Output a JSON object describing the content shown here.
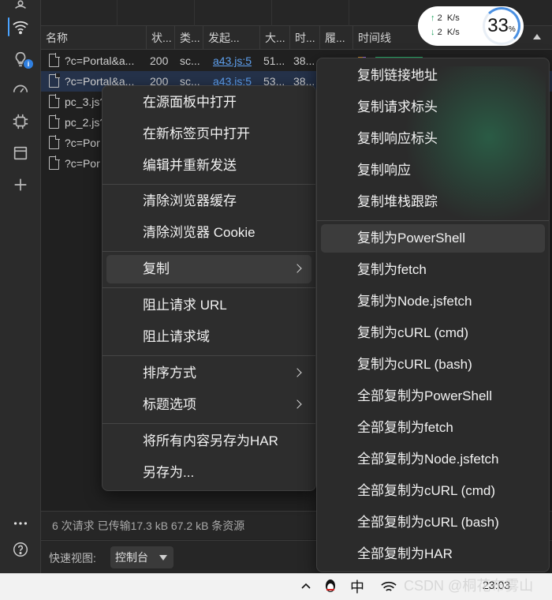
{
  "columns": [
    "名称",
    "状...",
    "类...",
    "发起...",
    "大...",
    "时...",
    "履...",
    "时间线"
  ],
  "rows": [
    {
      "name": "?c=Portal&a...",
      "status": "200",
      "type": "sc...",
      "initiator": "a43.js:5",
      "size": "51...",
      "time": "38..."
    },
    {
      "name": "?c=Portal&a...",
      "status": "200",
      "type": "sc...",
      "initiator": "a43.js:5",
      "size": "53...",
      "time": "38..."
    },
    {
      "name": "pc_3.js?",
      "status": "",
      "type": "",
      "initiator": "",
      "size": "",
      "time": ""
    },
    {
      "name": "pc_2.js?",
      "status": "",
      "type": "",
      "initiator": "",
      "size": "",
      "time": ""
    },
    {
      "name": "?c=Por",
      "status": "",
      "type": "",
      "initiator": "",
      "size": "",
      "time": ""
    },
    {
      "name": "?c=Por",
      "status": "",
      "type": "",
      "initiator": "",
      "size": "",
      "time": ""
    }
  ],
  "netmeter": {
    "up": "2",
    "down": "2",
    "unit": "K/s",
    "percent": "33",
    "percent_sign": "%",
    "up_arrow": "↑",
    "down_arrow": "↓"
  },
  "status_bar": "6 次请求  已传输17.3 kB  67.2 kB 条资源",
  "quick_view": {
    "label": "快速视图:",
    "value": "控制台"
  },
  "context_menu": {
    "open_sources": "在源面板中打开",
    "open_new_tab": "在新标签页中打开",
    "edit_resend": "编辑并重新发送",
    "clear_cache": "清除浏览器缓存",
    "clear_cookie": "清除浏览器 Cookie",
    "copy": "复制",
    "block_url": "阻止请求 URL",
    "block_domain": "阻止请求域",
    "sort_by": "排序方式",
    "header_options": "标题选项",
    "save_har": "将所有内容另存为HAR",
    "save_as": "另存为..."
  },
  "copy_menu": [
    "复制链接地址",
    "复制请求标头",
    "复制响应标头",
    "复制响应",
    "复制堆栈跟踪",
    "复制为PowerShell",
    "复制为fetch",
    "复制为Node.jsfetch",
    "复制为cURL (cmd)",
    "复制为cURL (bash)",
    "全部复制为PowerShell",
    "全部复制为fetch",
    "全部复制为Node.jsfetch",
    "全部复制为cURL (cmd)",
    "全部复制为cURL (bash)",
    "全部复制为HAR"
  ],
  "taskbar": {
    "ime": "中",
    "time": "23:03"
  },
  "watermark": "CSDN @桐花布雾山",
  "colors": {
    "accent": "#4aa3ff",
    "link": "#5ea0ef",
    "selected_row": "#25324a",
    "menu_bg": "#2d2d2d"
  },
  "icons": [
    "wifi-icon",
    "lightbulb-icon",
    "performance-icon",
    "cpu-icon",
    "window-icon",
    "plus-icon",
    "more-icon",
    "help-icon"
  ]
}
